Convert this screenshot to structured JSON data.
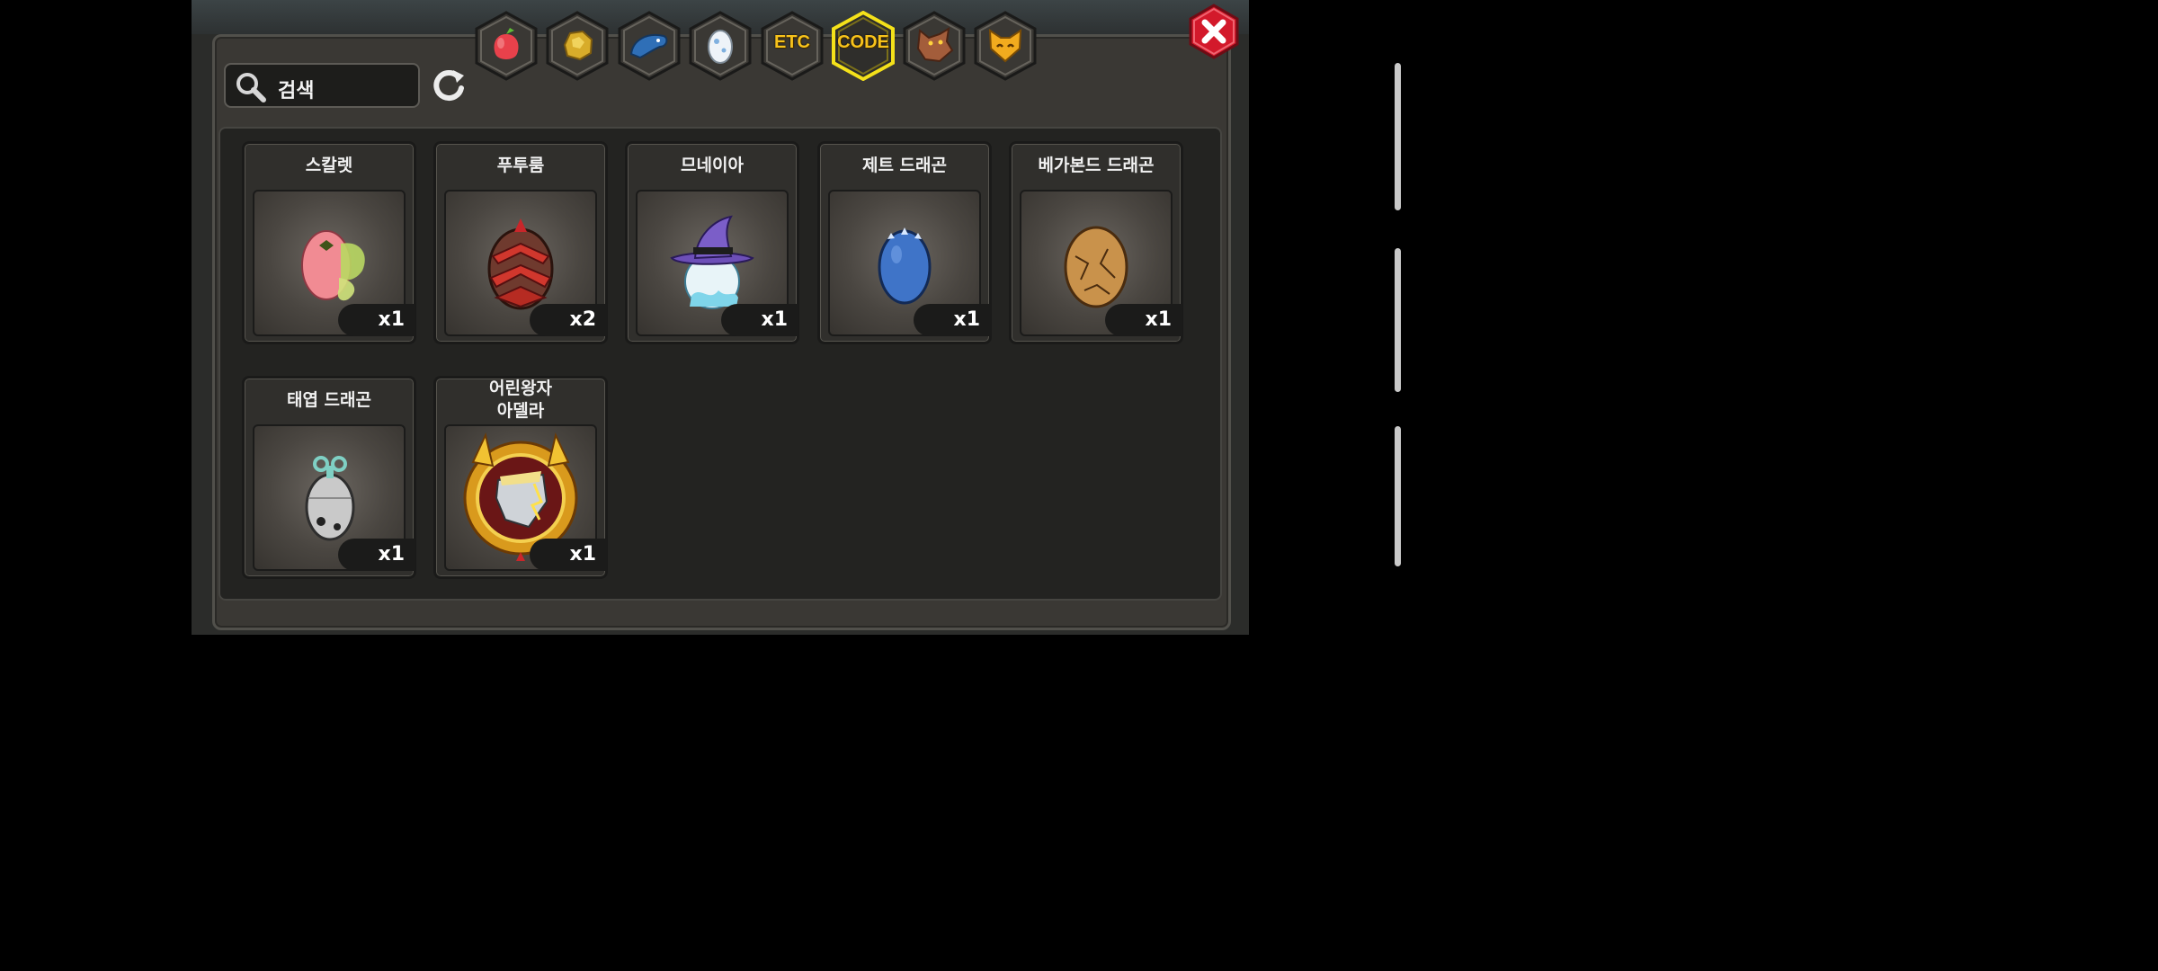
{
  "search": {
    "label": "검색"
  },
  "tabs": [
    {
      "name": "fruit",
      "label": "",
      "icon": "fruit-icon",
      "selected": false
    },
    {
      "name": "gold",
      "label": "",
      "icon": "gold-nugget-icon",
      "selected": false
    },
    {
      "name": "dragon-head",
      "label": "",
      "icon": "blue-dragon-icon",
      "selected": false
    },
    {
      "name": "egg",
      "label": "",
      "icon": "egg-icon",
      "selected": false
    },
    {
      "name": "etc",
      "label": "ETC",
      "icon": "",
      "selected": false
    },
    {
      "name": "code",
      "label": "CODE",
      "icon": "",
      "selected": true
    },
    {
      "name": "werewolf",
      "label": "",
      "icon": "werewolf-icon",
      "selected": false
    },
    {
      "name": "cat",
      "label": "",
      "icon": "cat-face-icon",
      "selected": false
    }
  ],
  "items": [
    {
      "name": "스칼렛",
      "count": "x1",
      "icon": "scarlet-egg-icon"
    },
    {
      "name": "푸투룸",
      "count": "x2",
      "icon": "puturum-egg-icon"
    },
    {
      "name": "므네이아",
      "count": "x1",
      "icon": "mneia-egg-icon"
    },
    {
      "name": "제트 드래곤",
      "count": "x1",
      "icon": "jet-dragon-egg-icon"
    },
    {
      "name": "베가본드 드래곤",
      "count": "x1",
      "icon": "vagabond-dragon-egg-icon"
    },
    {
      "name": "태엽 드래곤",
      "count": "x1",
      "icon": "clockwork-dragon-egg-icon"
    },
    {
      "name": "어린왕자\n아델라",
      "count": "x1",
      "icon": "little-prince-adela-emblem-icon"
    }
  ],
  "colors": {
    "selected_tab_border": "#f4e11a",
    "tab_label": "#f7c21b",
    "close_button": "#d3192b"
  }
}
